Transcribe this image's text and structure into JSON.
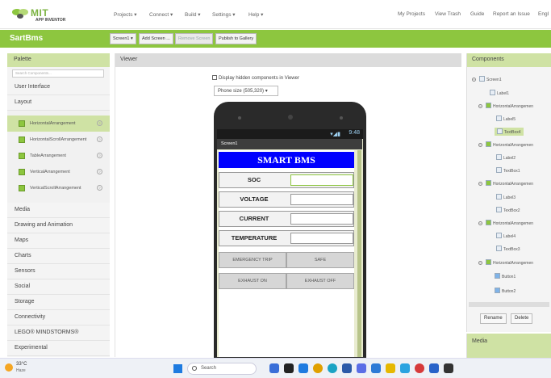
{
  "topnav": {
    "logo_text": "MIT",
    "logo_sub": "APP INVENTOR",
    "menus": [
      "Projects ▾",
      "Connect ▾",
      "Build ▾",
      "Settings ▾",
      "Help ▾"
    ],
    "links": [
      "My Projects",
      "View Trash",
      "Guide",
      "Report an Issue",
      "Engl"
    ]
  },
  "project": {
    "name": "SartBms",
    "screen_button": "Screen1 ▾",
    "add_screen": "Add Screen ...",
    "remove_screen": "Remove Screen",
    "publish": "Publish to Gallery"
  },
  "palette": {
    "title": "Palette",
    "search_placeholder": "Search Components...",
    "categories_top": [
      "User Interface",
      "Layout"
    ],
    "layout_items": [
      "HorizontalArrangement",
      "HorizontalScrollArrangement",
      "TableArrangement",
      "VerticalArrangement",
      "VerticalScrollArrangement"
    ],
    "categories_bottom": [
      "Media",
      "Drawing and Animation",
      "Maps",
      "Charts",
      "Sensors",
      "Social",
      "Storage",
      "Connectivity",
      "LEGO® MINDSTORMS®",
      "Experimental"
    ]
  },
  "viewer": {
    "title": "Viewer",
    "hidden_label": "Display hidden components in Viewer",
    "phone_size": "Phone size (505,320)  ▾",
    "status_time": "9:48",
    "screen_title": "Screen1",
    "app_title": "SMART BMS",
    "rows": [
      "SOC",
      "VOLTAGE",
      "CURRENT",
      "TEMPERATURE"
    ],
    "button_rows": [
      [
        "EMERGENCY TRIP",
        "SAFE"
      ],
      [
        "EXHAUST ON",
        "EXHAUST OFF"
      ]
    ]
  },
  "components": {
    "title": "Components",
    "tree": [
      "Screen1",
      "Label1",
      "HorizontalArrangemen",
      "Label5",
      "TextBox4",
      "HorizontalArrangemen",
      "Label2",
      "TextBox1",
      "HorizontalArrangemen",
      "Label3",
      "TextBox2",
      "HorizontalArrangemen",
      "Label4",
      "TextBox3",
      "HorizontalArrangemen",
      "Button1",
      "Button2"
    ],
    "rename": "Rename",
    "delete": "Delete",
    "media_title": "Media"
  },
  "taskbar": {
    "temp": "33°C",
    "weather": "Haze",
    "search": "Search"
  },
  "colors": {
    "brand_green": "#8dc63f",
    "panel_green": "#cfe2a4",
    "app_title_bg": "#0000ff"
  }
}
